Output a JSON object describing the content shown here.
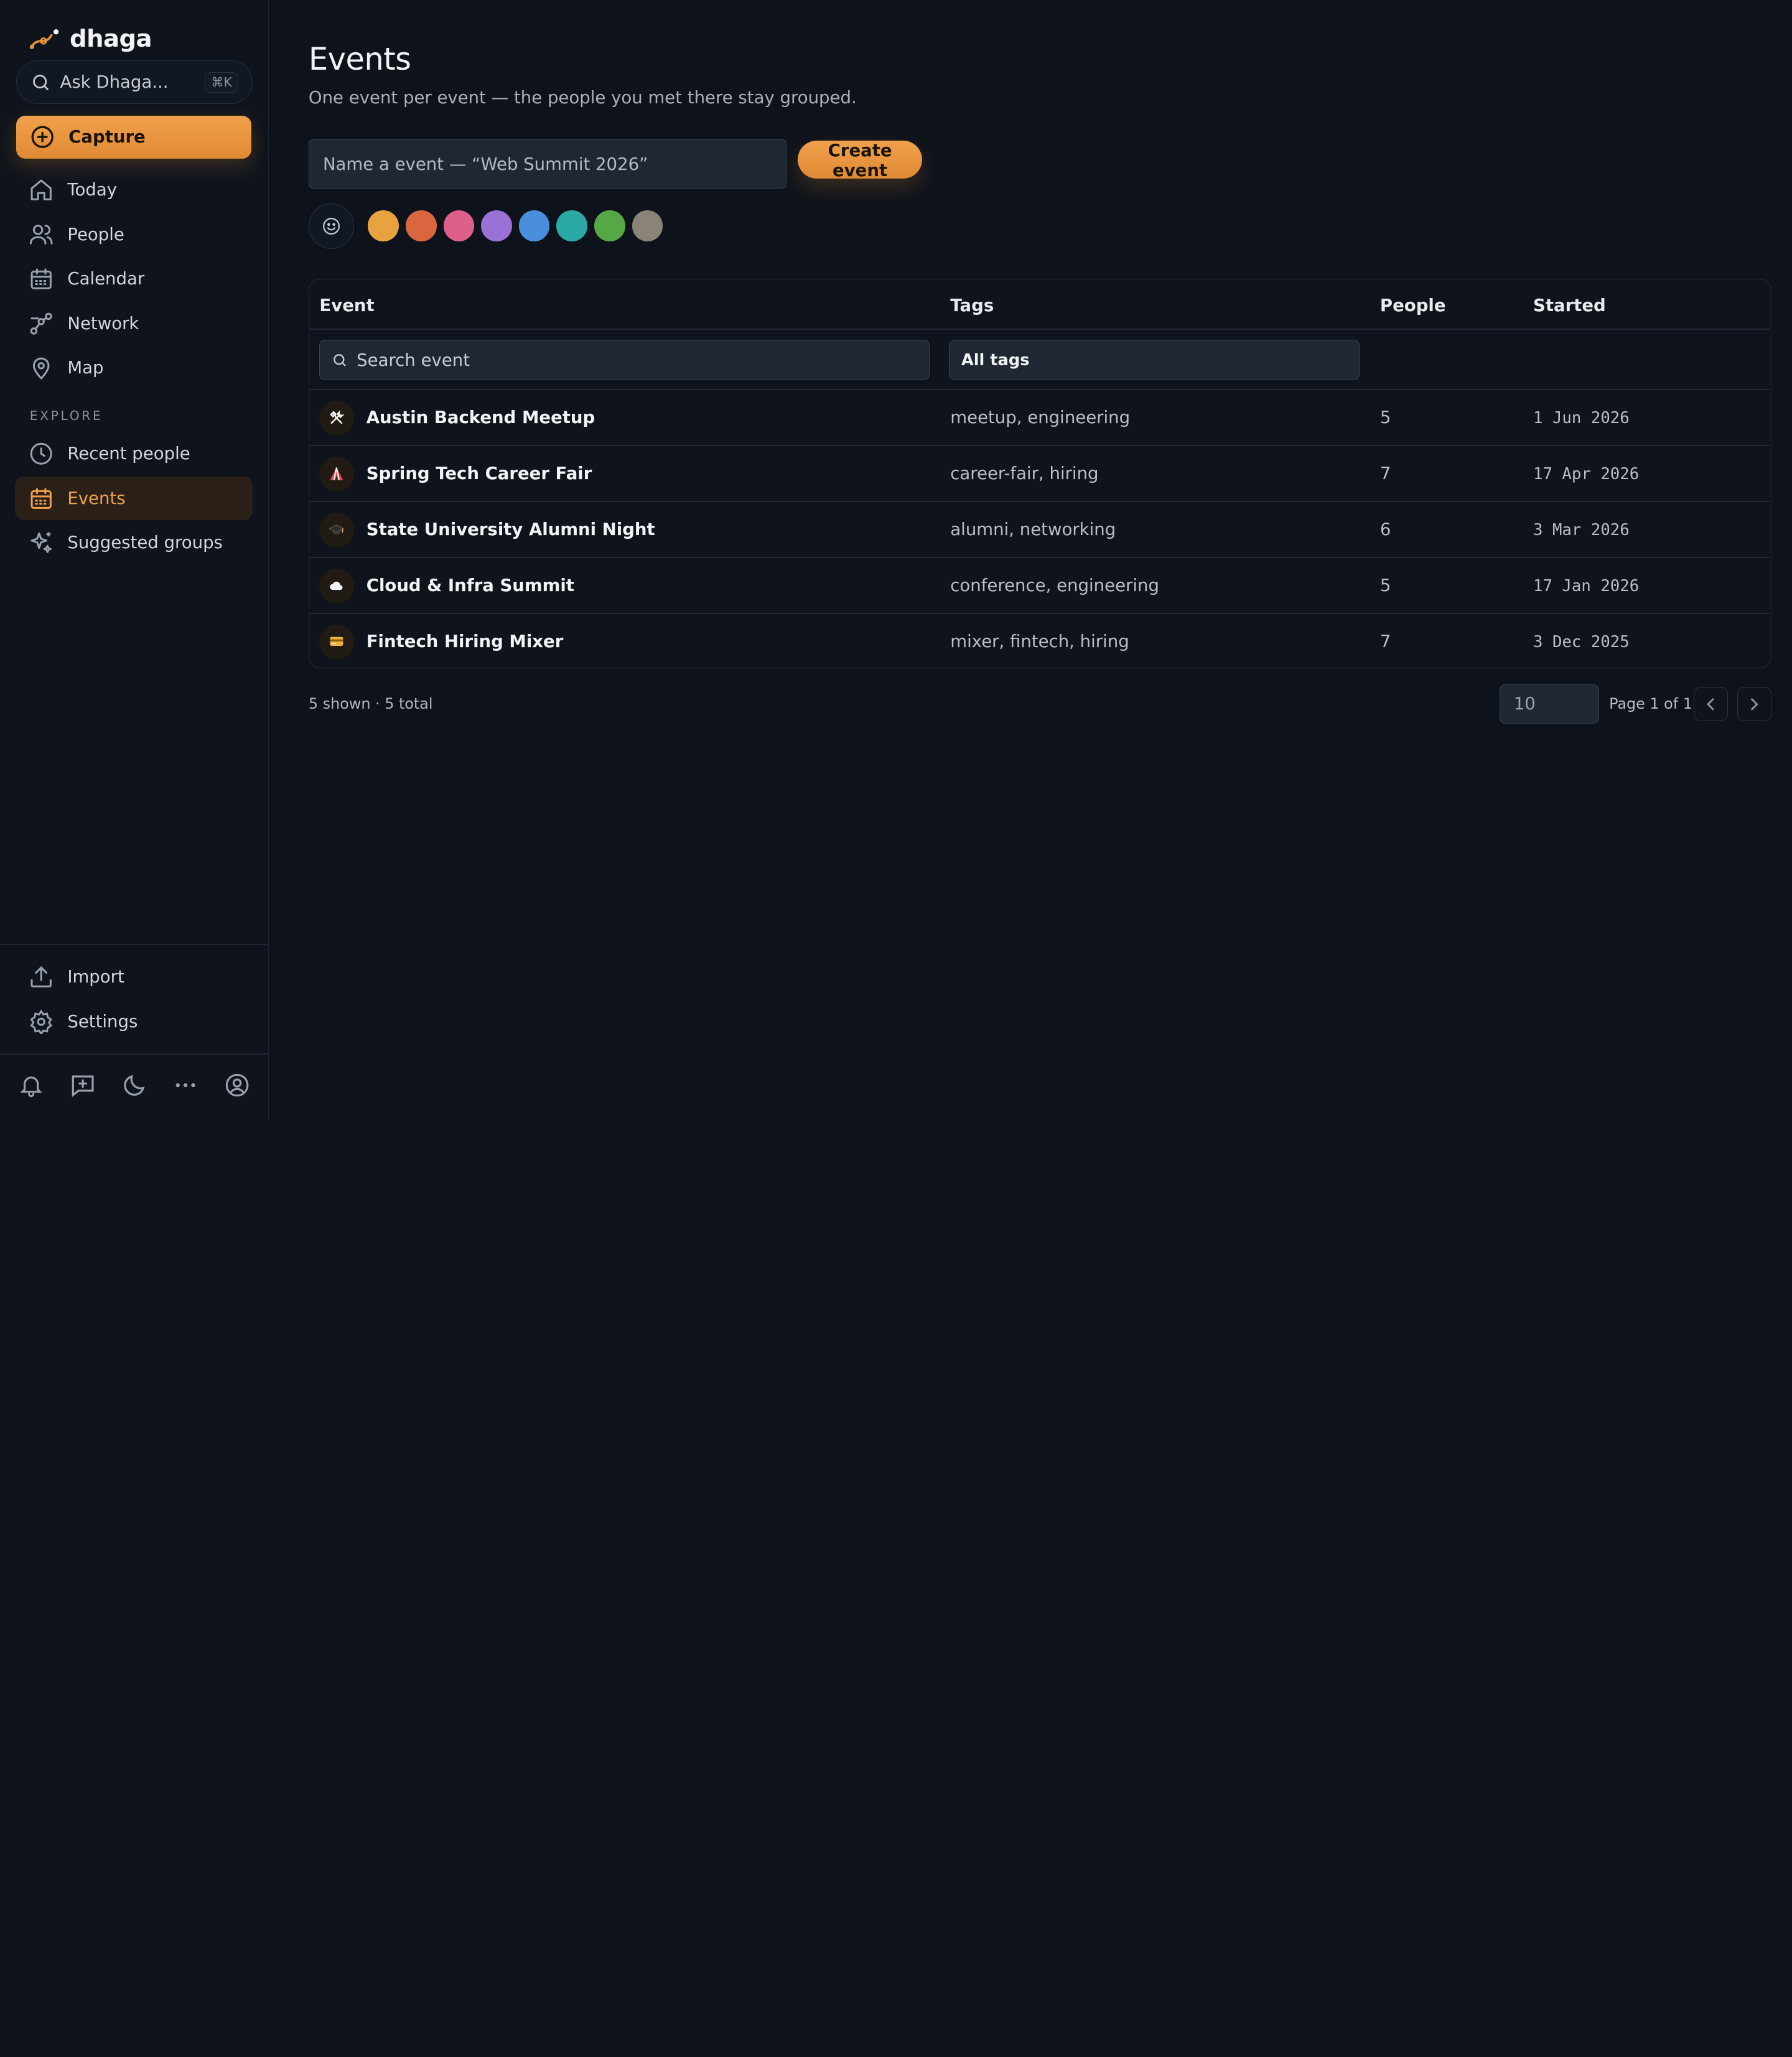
{
  "brand": {
    "name": "dhaga"
  },
  "search": {
    "label": "Ask Dhaga...",
    "shortcut": "⌘K"
  },
  "capture": {
    "label": "Capture"
  },
  "nav": [
    {
      "label": "Today",
      "icon": "home-icon"
    },
    {
      "label": "People",
      "icon": "people-icon"
    },
    {
      "label": "Calendar",
      "icon": "calendar-icon"
    },
    {
      "label": "Network",
      "icon": "network-icon"
    },
    {
      "label": "Map",
      "icon": "map-pin-icon"
    }
  ],
  "explore": {
    "heading": "EXPLORE",
    "items": [
      {
        "label": "Recent people",
        "icon": "clock-icon"
      },
      {
        "label": "Events",
        "icon": "calendar-icon",
        "active": true
      },
      {
        "label": "Suggested groups",
        "icon": "sparkles-icon"
      }
    ]
  },
  "footer_nav": [
    {
      "label": "Import",
      "icon": "upload-icon"
    },
    {
      "label": "Settings",
      "icon": "gear-icon"
    }
  ],
  "bottom_icons": [
    "bell-icon",
    "new-message-icon",
    "moon-icon",
    "more-icon",
    "account-icon"
  ],
  "page": {
    "title": "Events",
    "subtitle": "One event per event — the people you met there stay grouped."
  },
  "create": {
    "placeholder": "Name a event — “Web Summit 2026”",
    "button_label": "Create event",
    "emoji_icon": "smiley-icon",
    "colors": [
      "#e8a240",
      "#d9663e",
      "#de5f8a",
      "#9a72d6",
      "#4a8fdc",
      "#2aa9a6",
      "#56a847",
      "#8a8478"
    ]
  },
  "table": {
    "columns": [
      "Event",
      "Tags",
      "People",
      "Started"
    ],
    "search_placeholder": "Search event",
    "tag_filter": "All tags",
    "rows": [
      {
        "icon": "hammer-wrench-icon",
        "name": "Austin Backend Meetup",
        "tags": "meetup, engineering",
        "people": "5",
        "started": "1 Jun 2026"
      },
      {
        "icon": "circus-tent-icon",
        "name": "Spring Tech Career Fair",
        "tags": "career-fair, hiring",
        "people": "7",
        "started": "17 Apr 2026"
      },
      {
        "icon": "graduation-cap-icon",
        "name": "State University Alumni Night",
        "tags": "alumni, networking",
        "people": "6",
        "started": "3 Mar 2026"
      },
      {
        "icon": "cloud-icon",
        "name": "Cloud & Infra Summit",
        "tags": "conference, engineering",
        "people": "5",
        "started": "17 Jan 2026"
      },
      {
        "icon": "credit-card-icon",
        "name": "Fintech Hiring Mixer",
        "tags": "mixer, fintech, hiring",
        "people": "7",
        "started": "3 Dec 2025"
      }
    ]
  },
  "pagination": {
    "summary": "5 shown · 5 total",
    "page_size": "10",
    "page_label": "Page 1 of 1"
  }
}
